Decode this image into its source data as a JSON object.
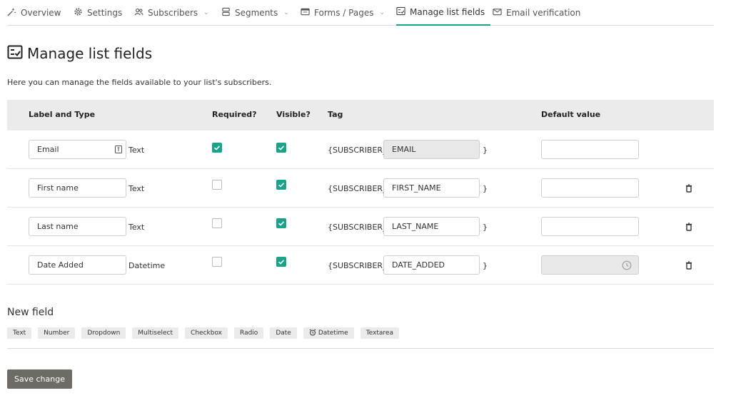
{
  "tabs": [
    {
      "label": "Overview",
      "icon": "wand-icon",
      "caret": false
    },
    {
      "label": "Settings",
      "icon": "gear-icon",
      "caret": false
    },
    {
      "label": "Subscribers",
      "icon": "users-icon",
      "caret": true
    },
    {
      "label": "Segments",
      "icon": "segments-icon",
      "caret": true
    },
    {
      "label": "Forms / Pages",
      "icon": "form-icon",
      "caret": true
    },
    {
      "label": "Manage list fields",
      "icon": "checklist-icon",
      "caret": false,
      "active": true
    },
    {
      "label": "Email verification",
      "icon": "envelope-check-icon",
      "caret": false
    }
  ],
  "page": {
    "title": "Manage list fields",
    "intro": "Here you can manage the fields available to your list's subscribers."
  },
  "table": {
    "headers": {
      "label_type": "Label and Type",
      "required": "Required?",
      "visible": "Visible?",
      "tag": "Tag",
      "default_value": "Default value"
    },
    "tag_prefix": "{SUBSCRIBER_",
    "tag_suffix": "}",
    "rows": [
      {
        "label": "Email",
        "type": "Text",
        "required": true,
        "visible": true,
        "tag": "EMAIL",
        "tag_disabled": true,
        "default": "",
        "default_disabled": false,
        "deletable": false
      },
      {
        "label": "First name",
        "type": "Text",
        "required": false,
        "visible": true,
        "tag": "FIRST_NAME",
        "tag_disabled": false,
        "default": "",
        "default_disabled": false,
        "deletable": true
      },
      {
        "label": "Last name",
        "type": "Text",
        "required": false,
        "visible": true,
        "tag": "LAST_NAME",
        "tag_disabled": false,
        "default": "",
        "default_disabled": false,
        "deletable": true
      },
      {
        "label": "Date Added",
        "type": "Datetime",
        "required": false,
        "visible": true,
        "tag": "DATE_ADDED",
        "tag_disabled": false,
        "default": "",
        "default_disabled": true,
        "deletable": true
      }
    ]
  },
  "new_field": {
    "title": "New field",
    "types": [
      "Text",
      "Number",
      "Dropdown",
      "Multiselect",
      "Checkbox",
      "Radio",
      "Date",
      "Datetime",
      "Textarea"
    ]
  },
  "save_label": "Save change",
  "colors": {
    "accent": "#1aa38a",
    "header_bg": "#ebebeb",
    "button_bg": "#6e6a65"
  }
}
